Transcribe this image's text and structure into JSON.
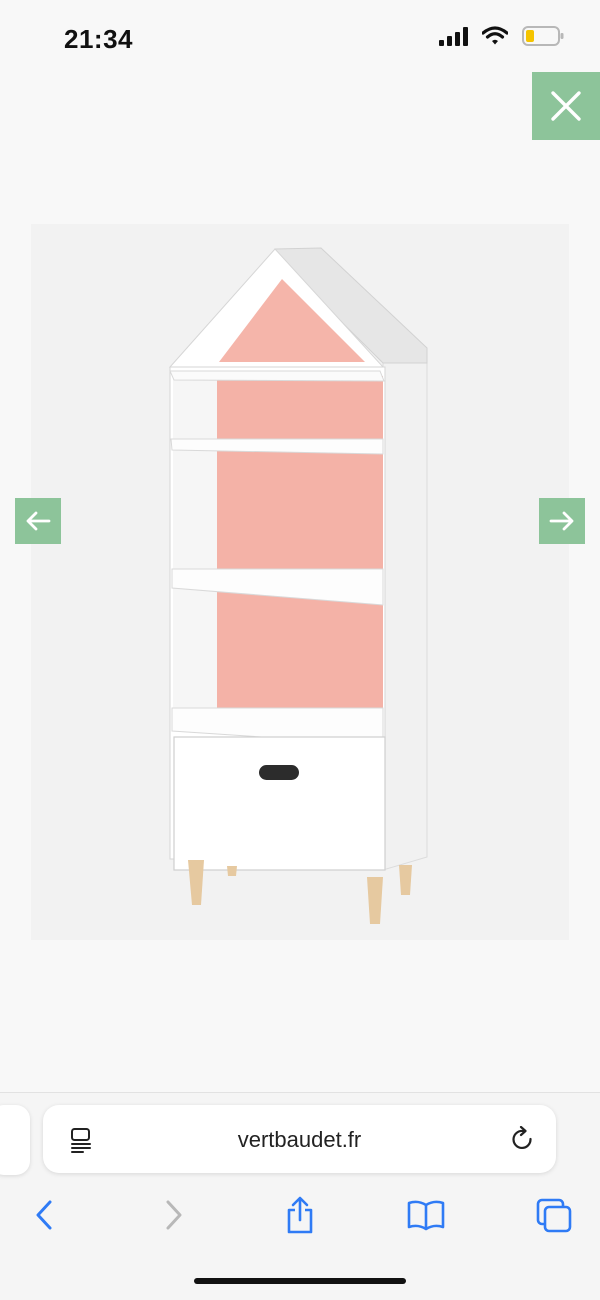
{
  "status_bar": {
    "time": "21:34",
    "signal_icon": "cellular-signal-icon",
    "wifi_icon": "wifi-icon",
    "battery_icon": "battery-low-icon",
    "battery_level": 0.2
  },
  "viewer": {
    "close_icon": "close-icon",
    "prev_icon": "arrow-left-icon",
    "next_icon": "arrow-right-icon",
    "accent_color": "#8dc49a",
    "product_image": "house-shaped-bookcase-with-pink-back-and-drawer"
  },
  "browser": {
    "url": "vertbaudet.fr",
    "reader_icon": "reader-mode-icon",
    "reload_icon": "reload-icon",
    "toolbar": {
      "back_icon": "chevron-left-icon",
      "forward_icon": "chevron-right-icon",
      "share_icon": "share-icon",
      "bookmarks_icon": "book-icon",
      "tabs_icon": "tabs-icon"
    },
    "link_color": "#2f7bf5"
  }
}
